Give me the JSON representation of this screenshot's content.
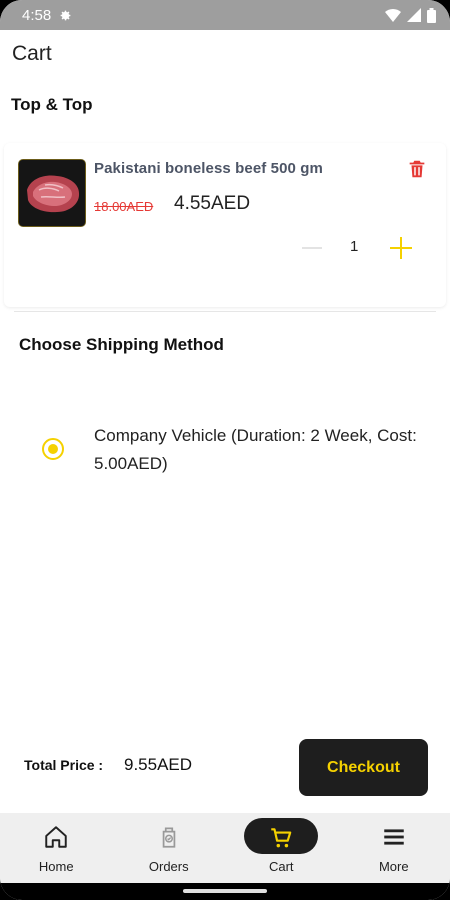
{
  "status_bar": {
    "time": "4:58"
  },
  "app_bar": {
    "title": "Cart"
  },
  "store": {
    "name": "Top & Top"
  },
  "cart_item": {
    "name": "Pakistani boneless beef 500 gm",
    "old_price": "18.00AED",
    "new_price": "4.55AED",
    "quantity": "1"
  },
  "shipping": {
    "title": "Choose Shipping Method",
    "option_label": "Company Vehicle (Duration: 2 Week, Cost: 5.00AED)",
    "selected": true
  },
  "summary": {
    "total_label": "Total Price :",
    "total_value": "9.55AED",
    "checkout_label": "Checkout"
  },
  "bottom_nav": {
    "items": [
      {
        "label": "Home",
        "icon": "home-icon"
      },
      {
        "label": "Orders",
        "icon": "orders-icon"
      },
      {
        "label": "Cart",
        "icon": "cart-icon",
        "active": true
      },
      {
        "label": "More",
        "icon": "menu-icon"
      }
    ]
  },
  "colors": {
    "accent": "#f5d100",
    "dark": "#1e1e1e",
    "sale_red": "#e53935",
    "nav_bg": "#efefef"
  }
}
